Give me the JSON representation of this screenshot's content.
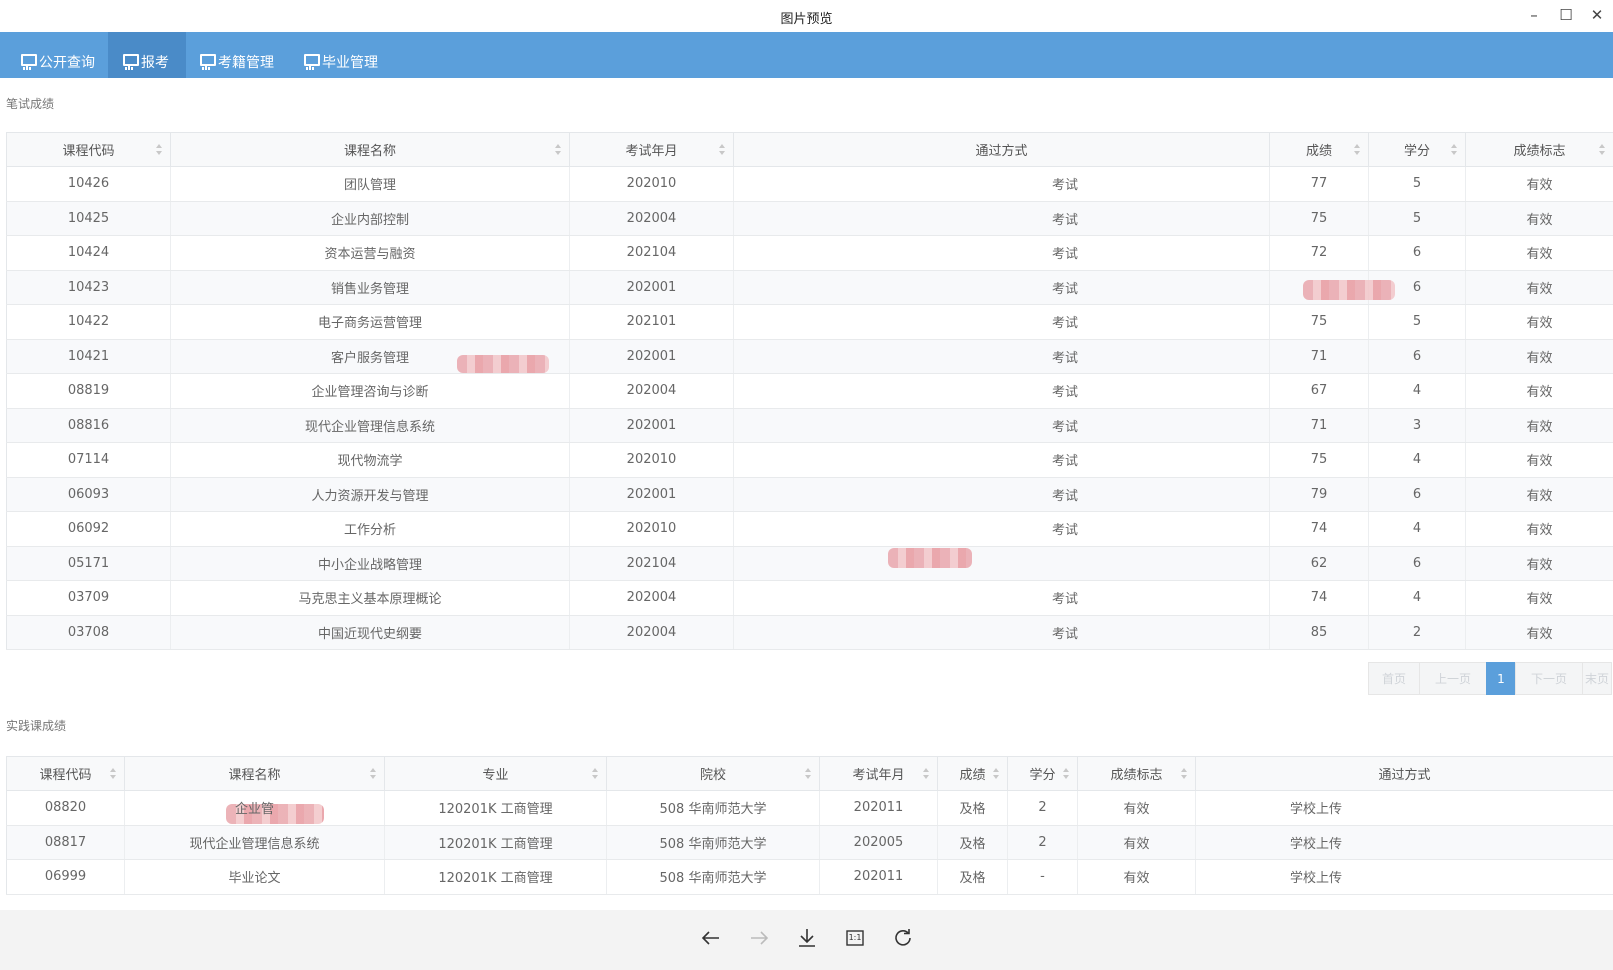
{
  "window": {
    "title": "图片预览",
    "minimize": "–",
    "maximize": "☐",
    "close": "✕"
  },
  "nav": {
    "tabs": [
      {
        "label": "公开查询"
      },
      {
        "label": "报考"
      },
      {
        "label": "考籍管理"
      },
      {
        "label": "毕业管理"
      }
    ],
    "active_tab": "报考"
  },
  "written": {
    "section_title": "笔试成绩",
    "columns": [
      "课程代码",
      "课程名称",
      "考试年月",
      "通过方式",
      "成绩",
      "学分",
      "成绩标志"
    ],
    "rows": [
      [
        "10426",
        "团队管理",
        "202010",
        "考试",
        "77",
        "5",
        "有效"
      ],
      [
        "10425",
        "企业内部控制",
        "202004",
        "考试",
        "75",
        "5",
        "有效"
      ],
      [
        "10424",
        "资本运营与融资",
        "202104",
        "考试",
        "72",
        "6",
        "有效"
      ],
      [
        "10423",
        "销售业务管理",
        "202001",
        "考试",
        "",
        "6",
        "有效"
      ],
      [
        "10422",
        "电子商务运营管理",
        "202101",
        "考试",
        "75",
        "5",
        "有效"
      ],
      [
        "10421",
        "客户服务管理",
        "202001",
        "考试",
        "71",
        "6",
        "有效"
      ],
      [
        "08819",
        "企业管理咨询与诊断",
        "202004",
        "考试",
        "67",
        "4",
        "有效"
      ],
      [
        "08816",
        "现代企业管理信息系统",
        "202001",
        "考试",
        "71",
        "3",
        "有效"
      ],
      [
        "07114",
        "现代物流学",
        "202010",
        "考试",
        "75",
        "4",
        "有效"
      ],
      [
        "06093",
        "人力资源开发与管理",
        "202001",
        "考试",
        "79",
        "6",
        "有效"
      ],
      [
        "06092",
        "工作分析",
        "202010",
        "考试",
        "74",
        "4",
        "有效"
      ],
      [
        "05171",
        "中小企业战略管理",
        "202104",
        "",
        "62",
        "6",
        "有效"
      ],
      [
        "03709",
        "马克思主义基本原理概论",
        "202004",
        "考试",
        "74",
        "4",
        "有效"
      ],
      [
        "03708",
        "中国近现代史纲要",
        "202004",
        "考试",
        "85",
        "2",
        "有效"
      ]
    ]
  },
  "pagination": {
    "first": "首页",
    "prev": "上一页",
    "current": "1",
    "next": "下一页",
    "last": "末页"
  },
  "practice": {
    "section_title": "实践课成绩",
    "columns": [
      "课程代码",
      "课程名称",
      "专业",
      "院校",
      "考试年月",
      "成绩",
      "学分",
      "成绩标志",
      "通过方式"
    ],
    "rows": [
      [
        "08820",
        "企业管",
        "120201K 工商管理",
        "508 华南师范大学",
        "202011",
        "及格",
        "2",
        "有效",
        "学校上传"
      ],
      [
        "08817",
        "现代企业管理信息系统",
        "120201K 工商管理",
        "508 华南师范大学",
        "202005",
        "及格",
        "2",
        "有效",
        "学校上传"
      ],
      [
        "06999",
        "毕业论文",
        "120201K 工商管理",
        "508 华南师范大学",
        "202011",
        "及格",
        "-",
        "有效",
        "学校上传"
      ]
    ]
  },
  "toolbar": {
    "icons": [
      "back-arrow-icon",
      "forward-arrow-icon",
      "download-icon",
      "actual-size-icon",
      "rotate-icon"
    ],
    "actual_size_label": "1:1"
  },
  "colors": {
    "nav_bg": "#5b9fdb",
    "nav_active": "#4a8bc8",
    "accent": "#5b9fdb"
  }
}
